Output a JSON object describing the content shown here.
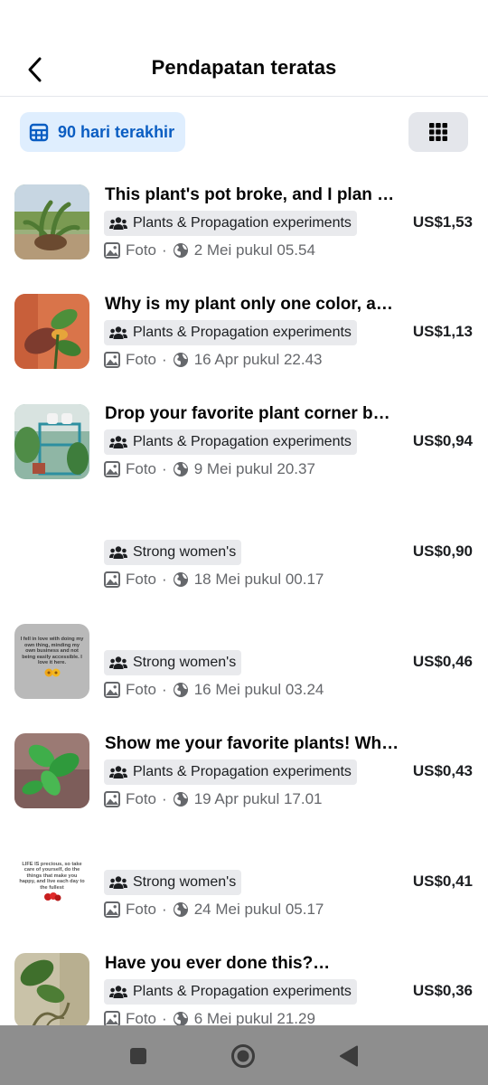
{
  "header": {
    "title": "Pendapatan teratas"
  },
  "filter": {
    "date_range": "90 hari terakhir"
  },
  "posts": [
    {
      "title": "This plant's pot broke, and I plan to…",
      "group": "Plants & Propagation experiments",
      "type": "Foto",
      "date": "2 Mei pukul 05.54",
      "earning": "US$1,53"
    },
    {
      "title": "Why is my plant only one color, and …",
      "group": "Plants & Propagation experiments",
      "type": "Foto",
      "date": "16 Apr pukul 22.43",
      "earning": "US$1,13"
    },
    {
      "title": "Drop your favorite plant corner belo…",
      "group": "Plants & Propagation experiments",
      "type": "Foto",
      "date": "9 Mei pukul 20.37",
      "earning": "US$0,94"
    },
    {
      "title": "",
      "group": "Strong women's",
      "type": "Foto",
      "date": "18 Mei pukul 00.17",
      "earning": "US$0,90"
    },
    {
      "title": "",
      "group": "Strong women's",
      "type": "Foto",
      "date": "16 Mei pukul 03.24",
      "earning": "US$0,46",
      "thumb_text": "I fell in love with doing my own thing, minding my own business and not being easily accessible. I love it here."
    },
    {
      "title": "Show me your favorite plants! Whet…",
      "group": "Plants & Propagation experiments",
      "type": "Foto",
      "date": "19 Apr pukul 17.01",
      "earning": "US$0,43"
    },
    {
      "title": "",
      "group": "Strong women's",
      "type": "Foto",
      "date": "24 Mei pukul 05.17",
      "earning": "US$0,41",
      "thumb_text": "LIFE IS precious, so take care of yourself, do the things that make you happy, and live each day to the fullest"
    },
    {
      "title": "Have you ever done this?…",
      "group": "Plants & Propagation experiments",
      "type": "Foto",
      "date": "6 Mei pukul 21.29",
      "earning": "US$0,36"
    }
  ],
  "colors": {
    "accent": "#0a5dc2",
    "chip_bg": "#dfeefe",
    "muted": "#65676b",
    "navbar": "#8e8e8e"
  },
  "icons": {
    "back": "chevron-left-icon",
    "calendar": "calendar-icon",
    "grid": "grid-icon",
    "group": "group-icon",
    "photo": "photo-icon",
    "globe": "globe-icon"
  }
}
